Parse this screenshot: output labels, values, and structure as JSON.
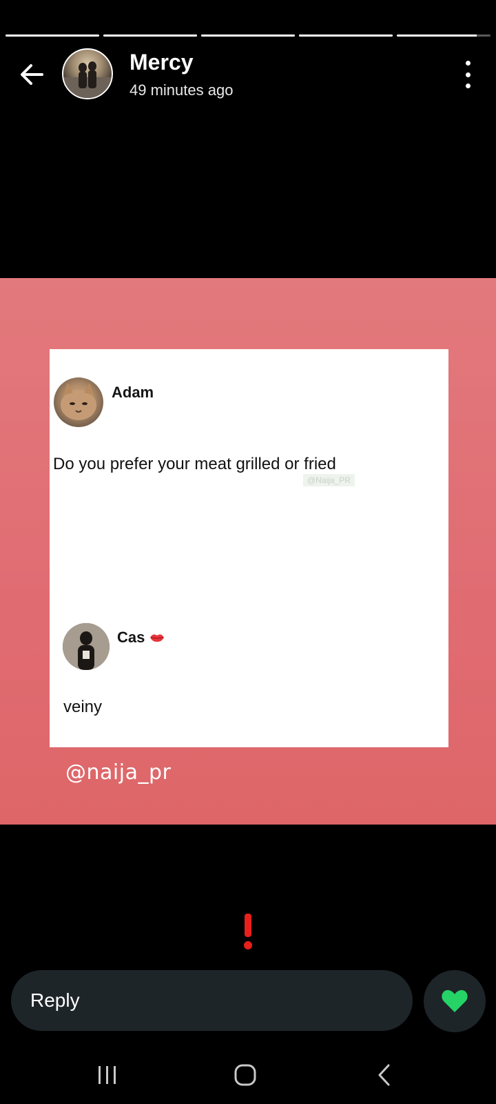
{
  "story": {
    "segments_progress": [
      1,
      1,
      1,
      1,
      0.85
    ],
    "user_name": "Mercy",
    "time_ago": "49 minutes ago"
  },
  "post": {
    "author": "Adam",
    "question": "Do you prefer your meat grilled or fried",
    "watermark": "@Naija_PR",
    "reply_author": "Cas",
    "reply_text": "veiny",
    "handle": "@naija_pr"
  },
  "reply": {
    "placeholder": "Reply"
  },
  "colors": {
    "story_bg": "#e0747a",
    "like_heart": "#25d366",
    "alert": "#e8201c",
    "reply_bar": "#1e2529"
  },
  "icons": {
    "back": "arrow-left-icon",
    "menu": "more-vertical-icon",
    "like": "heart-icon",
    "alert": "exclamation-icon",
    "nav_recent": "recent-apps-icon",
    "nav_home": "home-icon",
    "nav_back": "chevron-left-icon"
  }
}
